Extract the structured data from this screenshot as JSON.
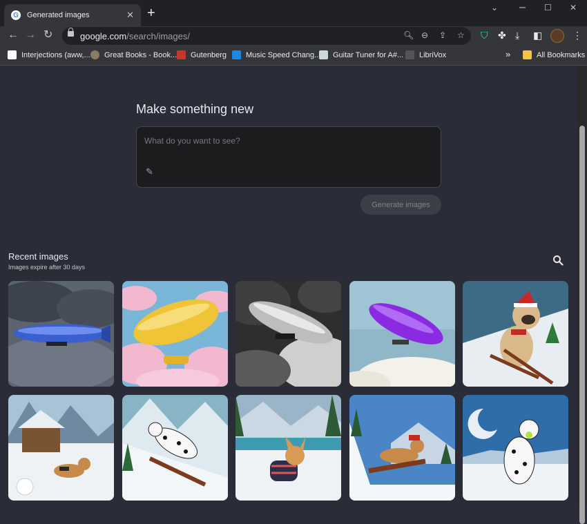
{
  "browser": {
    "tab_title": "Generated images",
    "tab_favicon": "G",
    "url_host": "google.com",
    "url_path": "/search/images/",
    "bookmarks": [
      {
        "label": "Interjections (aww,...",
        "icon": "book-figure-icon",
        "color": "#ffffff"
      },
      {
        "label": "Great Books - Book...",
        "icon": "portrait-icon",
        "color": "#8a7a6a"
      },
      {
        "label": "Gutenberg",
        "icon": "pg-icon",
        "color": "#c0392b"
      },
      {
        "label": "Music Speed Chang...",
        "icon": "music-icon",
        "color": "#1e88e5"
      },
      {
        "label": "Guitar Tuner for A#...",
        "icon": "tuner-icon",
        "color": "#cfd8dc"
      },
      {
        "label": "LibriVox",
        "icon": "librivox-icon",
        "color": "#555555"
      }
    ],
    "all_bookmarks_label": "All Bookmarks",
    "overflow_label": "»"
  },
  "create": {
    "heading": "Make something new",
    "prompt_placeholder": "What do you want to see?",
    "generate_label": "Generate images"
  },
  "recent": {
    "heading": "Recent images",
    "subtext": "Images expire after 30 days",
    "images": [
      {
        "subject": "blue-airship-storm-image"
      },
      {
        "subject": "yellow-airship-pink-clouds-image"
      },
      {
        "subject": "grey-airship-bw-clouds-image"
      },
      {
        "subject": "purple-airship-sky-image"
      },
      {
        "subject": "pug-skiing-santa-hat-image"
      },
      {
        "subject": "beagle-cabin-snow-image"
      },
      {
        "subject": "dalmatian-sled-image"
      },
      {
        "subject": "chihuahua-sweater-lake-image"
      },
      {
        "subject": "beagle-sled-scarf-image"
      },
      {
        "subject": "dalmatian-ball-snow-image"
      }
    ]
  },
  "colors": {
    "page_bg": "#2a2d37",
    "chrome_dark": "#202124",
    "chrome_toolbar": "#35363a",
    "accent_teal": "#1de9b6"
  }
}
